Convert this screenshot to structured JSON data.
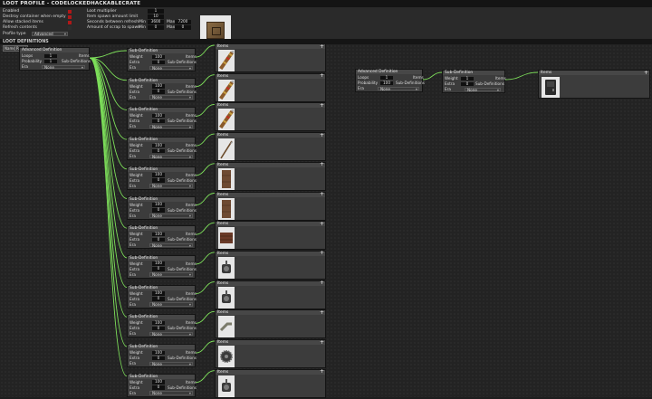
{
  "window_title": "LOOT PROFILE - CODELOCKEDHACKABLECRATE",
  "settings": {
    "enabled": "Enabled",
    "destroy_when_empty": "Destroy container when empty",
    "allow_stacked": "Allow stacked items",
    "refresh_contents": "Refresh contents",
    "profile_type_label": "Profile type",
    "profile_type_value": "Advanced",
    "loot_multiplier_label": "Loot multiplier",
    "loot_multiplier_value": "1",
    "item_spawn_limit_label": "Item spawn amount limit",
    "item_spawn_limit_value": "10",
    "seconds_refresh_label": "Seconds between refresh",
    "amount_scrap_label": "Amount of scrap to spawn",
    "min_label": "Min",
    "max_label": "Max",
    "refresh_min": "3600",
    "refresh_max": "7200",
    "scrap_min": "0",
    "scrap_max": "0",
    "checkbox_color": "#b01818"
  },
  "section_title": "LOOT DEFINITIONS",
  "toolbar": {
    "name_label": "Name",
    "reset_label": "Reset"
  },
  "labels": {
    "advanced_definition": "Advanced Definition",
    "sub_definition": "Sub-Definition",
    "items": "Items",
    "loops": "Loops",
    "probability": "Probability",
    "era": "Era",
    "weight": "Weight",
    "extra": "Extra",
    "sub_definitions": "Sub-Definitions",
    "none": "None"
  },
  "root_node": {
    "loops": "1",
    "probability": "1",
    "era": "None"
  },
  "sub_nodes": [
    {
      "weight": "100",
      "extra": "0",
      "era": "None",
      "item_icon": "rocket-icon"
    },
    {
      "weight": "100",
      "extra": "0",
      "era": "None",
      "item_icon": "rocket-icon"
    },
    {
      "weight": "100",
      "extra": "0",
      "era": "None",
      "item_icon": "rocket-icon"
    },
    {
      "weight": "100",
      "extra": "0",
      "era": "None",
      "item_icon": "spear-icon"
    },
    {
      "weight": "100",
      "extra": "0",
      "era": "None",
      "item_icon": "wood-door-icon"
    },
    {
      "weight": "100",
      "extra": "0",
      "era": "None",
      "item_icon": "wood-door-icon"
    },
    {
      "weight": "100",
      "extra": "0",
      "era": "None",
      "item_icon": "barricade-icon"
    },
    {
      "weight": "100",
      "extra": "0",
      "era": "None",
      "item_icon": "turret-icon"
    },
    {
      "weight": "100",
      "extra": "0",
      "era": "None",
      "item_icon": "turret-icon"
    },
    {
      "weight": "100",
      "extra": "0",
      "era": "None",
      "item_icon": "pipe-icon"
    },
    {
      "weight": "100",
      "extra": "0",
      "era": "None",
      "item_icon": "gear-icon"
    },
    {
      "weight": "100",
      "extra": "0",
      "era": "None",
      "item_icon": "turret-icon"
    }
  ],
  "second_adv": {
    "loops": "1",
    "probability": "100",
    "era": "None"
  },
  "second_sub": {
    "weight": "1",
    "extra": "0",
    "era": "None",
    "item_icon": "armor-door-icon"
  },
  "wire_color": "#7ddf5a"
}
